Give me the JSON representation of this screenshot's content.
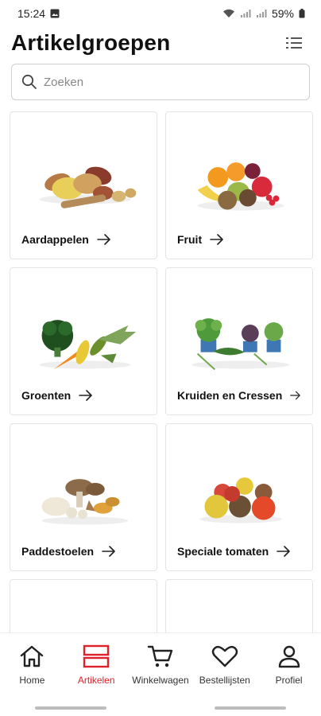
{
  "status_bar": {
    "time": "15:24",
    "battery": "59%"
  },
  "header": {
    "title": "Artikelgroepen"
  },
  "search": {
    "placeholder": "Zoeken"
  },
  "categories": [
    {
      "label": "Aardappelen"
    },
    {
      "label": "Fruit"
    },
    {
      "label": "Groenten"
    },
    {
      "label": "Kruiden en Cressen"
    },
    {
      "label": "Paddestoelen"
    },
    {
      "label": "Speciale tomaten"
    }
  ],
  "nav": [
    {
      "label": "Home",
      "icon": "home-icon"
    },
    {
      "label": "Artikelen",
      "icon": "articles-icon",
      "active": true
    },
    {
      "label": "Winkelwagen",
      "icon": "cart-icon"
    },
    {
      "label": "Bestellijsten",
      "icon": "heart-icon"
    },
    {
      "label": "Profiel",
      "icon": "profile-icon"
    }
  ],
  "colors": {
    "accent": "#e0212b",
    "text": "#111111",
    "border": "#e4e4e4"
  }
}
